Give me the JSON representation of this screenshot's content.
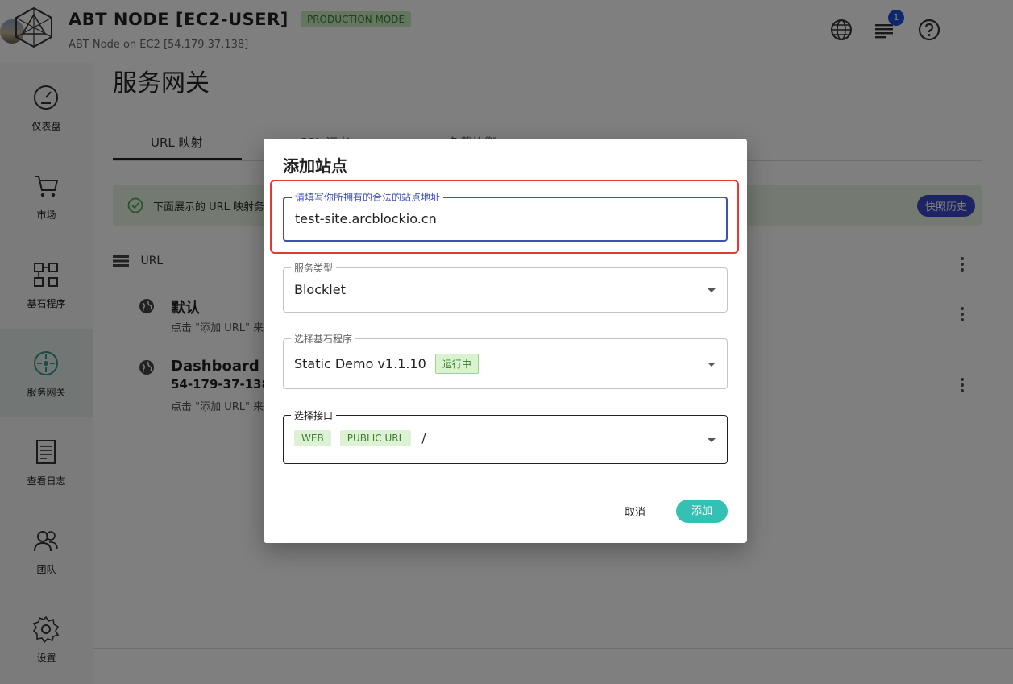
{
  "header": {
    "title": "ABT NODE [EC2-USER]",
    "mode": "PRODUCTION MODE",
    "subtitle": "ABT Node on EC2 [54.179.37.138]",
    "notifications": "1"
  },
  "sidebar": {
    "items": [
      {
        "label": "仪表盘",
        "icon": "dashboard-icon"
      },
      {
        "label": "市场",
        "icon": "cart-icon"
      },
      {
        "label": "基石程序",
        "icon": "blocklet-icon"
      },
      {
        "label": "服务网关",
        "icon": "gateway-icon"
      },
      {
        "label": "查看日志",
        "icon": "log-icon"
      },
      {
        "label": "团队",
        "icon": "team-icon"
      },
      {
        "label": "设置",
        "icon": "gear-icon"
      }
    ],
    "active": "服务网关"
  },
  "main": {
    "page_title": "服务网关",
    "tabs": [
      {
        "label": "URL 映射"
      },
      {
        "label": "SSL 证书"
      },
      {
        "label": "负载均衡"
      }
    ],
    "alert_text": "下面展示的 URL 映射务",
    "snapshot_label": "快照历史",
    "url_header": "URL",
    "rows": [
      {
        "title": "默认",
        "subtitle": "点击 \"添加 URL\" 来"
      },
      {
        "title": "Dashboard",
        "host": "54-179-37-138.",
        "subtitle": "点击 \"添加 URL\" 来"
      }
    ]
  },
  "dialog": {
    "title": "添加站点",
    "site_field": {
      "label": "请填写你所拥有的合法的站点地址",
      "value": "test-site.arcblockio.cn"
    },
    "service_type": {
      "label": "服务类型",
      "value": "Blocklet"
    },
    "blocklet": {
      "label": "选择基石程序",
      "value": "Static Demo v1.1.10",
      "status": "运行中"
    },
    "interface": {
      "label": "选择接口",
      "chips": [
        "WEB",
        "PUBLIC URL"
      ],
      "path": "/"
    },
    "cancel_label": "取消",
    "add_label": "添加"
  },
  "colors": {
    "accent": "#3f51b5",
    "primary_button": "#34c0b3",
    "highlight": "#e53935",
    "badge_green": "#c9ecc1"
  }
}
